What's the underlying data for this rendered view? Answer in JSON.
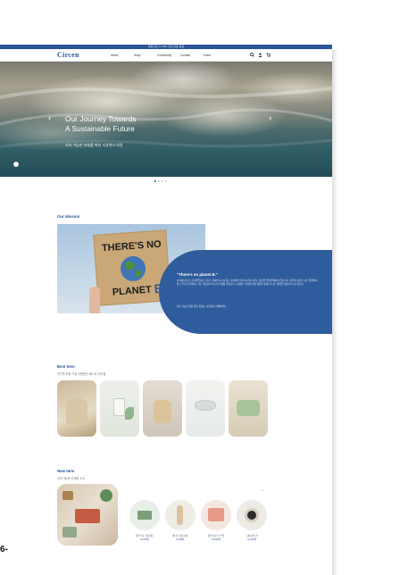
{
  "topbar": {
    "text": "회원가입 시 10% 할인 쿠폰 증정"
  },
  "header": {
    "logo": "Circen",
    "nav": [
      "About",
      "Shop",
      "Community",
      "Contact",
      "Event"
    ]
  },
  "hero": {
    "title_line1": "Our Journey Towards",
    "title_line2": "A Sustainable Future",
    "subtitle": "지속 가능한 미래를 위한 서큐렌의 여정",
    "slides": 4,
    "active_slide": 1
  },
  "mission": {
    "heading": "Our Mission",
    "sign_text": "THERE'S NO PLANET B",
    "title": "\"There's no planet B.\"",
    "body": "이 세상 지구는 하나뿐입니다. 지구는 제2의 지구를 찾는 동안에 우리의 지구를 지키는 것만을 위해 존재하지 않습니다. 자연과 인간은 서로 연결되어 있고 우리가 선택하는 작은 행동들이 지구의 미래를 바꿉니다. 서큐렌은 환경을 위한 제품을 통해 더 나은 내일을 만들어가고자 합니다.",
    "foot": "지속 가능한 삶을 위한 첫걸음, 서큐렌과 함께하세요."
  },
  "best": {
    "heading": "Best Item",
    "sub": "지구를 위한 가장 사랑받는 베스트 아이템"
  },
  "new_items": {
    "heading": "New Item",
    "sub": "지속가능한 신제품 소식",
    "products": [
      {
        "name": "천연 비누 선물세트",
        "price": "12,000원"
      },
      {
        "name": "대나무 칫솔 세트",
        "price": "8,000원"
      },
      {
        "name": "천연 향균 스크럽",
        "price": "15,000원"
      },
      {
        "name": "고체 샴푸 바",
        "price": "11,000원"
      }
    ]
  },
  "page_number": "6-",
  "colors": {
    "brand": "#2d5597",
    "mission_box": "#2f5c9c"
  }
}
